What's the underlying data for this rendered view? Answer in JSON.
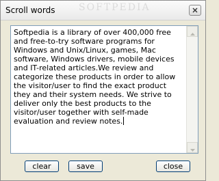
{
  "window": {
    "title": "Scroll words",
    "watermark": "SOFTPEDIA"
  },
  "editor": {
    "text": "Softpedia is a library of over 400,000 free and free-to-try software programs for Windows and Unix/Linux, games, Mac software, Windows drivers, mobile devices and IT-related articles.We review and categorize these products in order to allow the visitor/user to find the exact product they and their system needs. We strive to deliver only the best products to the visitor/user together with self-made evaluation and review notes."
  },
  "buttons": {
    "clear": "clear",
    "save": "save",
    "close": "close"
  },
  "icons": {
    "close": "close-icon",
    "scroll_up": "chevron-up-icon",
    "scroll_down": "chevron-down-icon"
  }
}
